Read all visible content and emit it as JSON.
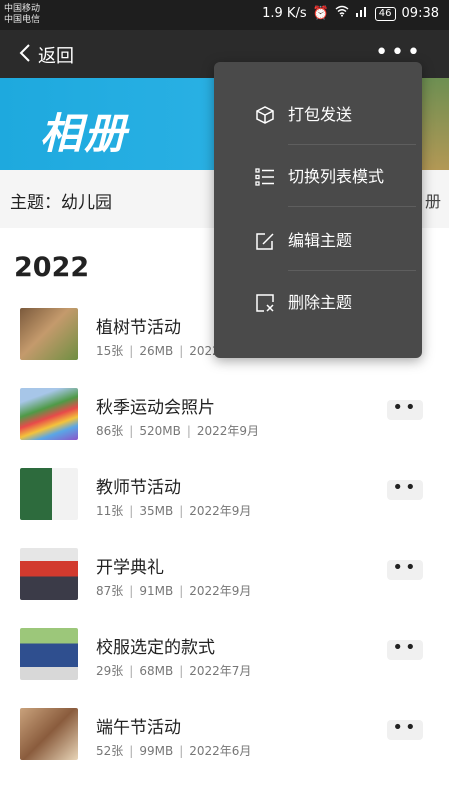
{
  "status_bar": {
    "carrier_1": "中国移动",
    "carrier_2": "中国电信",
    "speed": "1.9 K/s",
    "battery": "46",
    "time": "09:38"
  },
  "nav": {
    "back_label": "返回",
    "more_icon": "more-dots-icon"
  },
  "banner": {
    "text": "相册"
  },
  "theme": {
    "label": "主题：幼儿园",
    "tail": "册"
  },
  "year": "2022",
  "albums": [
    {
      "title": "植树节活动",
      "count": "15张",
      "size": "26MB",
      "date": "2022年"
    },
    {
      "title": "秋季运动会照片",
      "count": "86张",
      "size": "520MB",
      "date": "2022年9月"
    },
    {
      "title": "教师节活动",
      "count": "11张",
      "size": "35MB",
      "date": "2022年9月"
    },
    {
      "title": "开学典礼",
      "count": "87张",
      "size": "91MB",
      "date": "2022年9月"
    },
    {
      "title": "校服选定的款式",
      "count": "29张",
      "size": "68MB",
      "date": "2022年7月"
    },
    {
      "title": "端午节活动",
      "count": "52张",
      "size": "99MB",
      "date": "2022年6月"
    }
  ],
  "menu": {
    "items": [
      {
        "label": "打包发送",
        "icon": "package-icon"
      },
      {
        "label": "切换列表模式",
        "icon": "list-icon"
      },
      {
        "label": "编辑主题",
        "icon": "edit-icon"
      },
      {
        "label": "删除主题",
        "icon": "delete-icon"
      }
    ]
  },
  "colors": {
    "banner": "#1ea9de",
    "menu_bg": "#4a4a4a",
    "nav_bg": "#2b2b2b"
  }
}
